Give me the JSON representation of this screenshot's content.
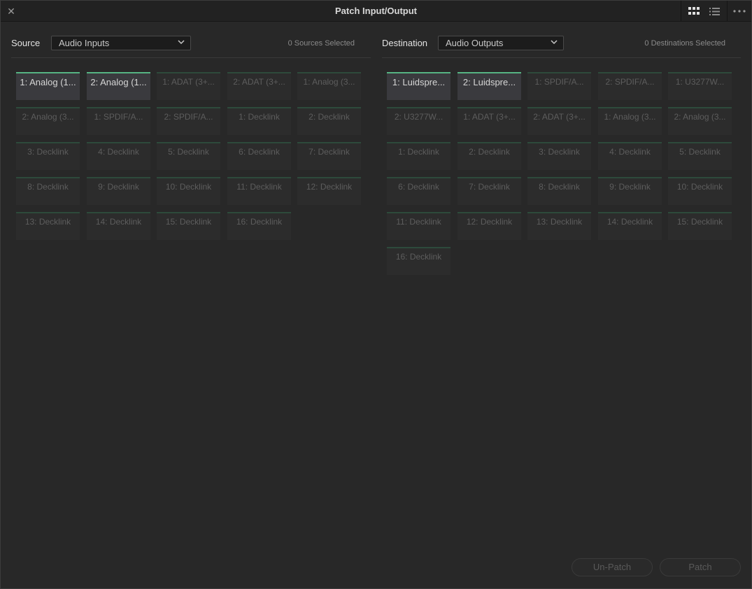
{
  "window": {
    "title": "Patch Input/Output"
  },
  "icons": {
    "close": "close-icon",
    "grid_view": "grid-view-icon",
    "list_view": "list-view-icon",
    "more": "more-options-icon",
    "chevron": "chevron-down-icon"
  },
  "colors": {
    "active_accent": "#56b483",
    "inactive_accent": "#2d4a3b",
    "background": "#282828"
  },
  "source": {
    "label": "Source",
    "dropdown_value": "Audio Inputs",
    "count_text": "0 Sources Selected",
    "tiles": [
      {
        "label": "1: Analog (1...",
        "active": true
      },
      {
        "label": "2: Analog (1...",
        "active": true
      },
      {
        "label": "1: ADAT (3+...",
        "active": false
      },
      {
        "label": "2: ADAT (3+...",
        "active": false
      },
      {
        "label": "1: Analog (3...",
        "active": false
      },
      {
        "label": "2: Analog (3...",
        "active": false
      },
      {
        "label": "1: SPDIF/A...",
        "active": false
      },
      {
        "label": "2: SPDIF/A...",
        "active": false
      },
      {
        "label": "1: Decklink",
        "active": false
      },
      {
        "label": "2: Decklink",
        "active": false
      },
      {
        "label": "3: Decklink",
        "active": false
      },
      {
        "label": "4: Decklink",
        "active": false
      },
      {
        "label": "5: Decklink",
        "active": false
      },
      {
        "label": "6: Decklink",
        "active": false
      },
      {
        "label": "7: Decklink",
        "active": false
      },
      {
        "label": "8: Decklink",
        "active": false
      },
      {
        "label": "9: Decklink",
        "active": false
      },
      {
        "label": "10: Decklink",
        "active": false
      },
      {
        "label": "11: Decklink",
        "active": false
      },
      {
        "label": "12: Decklink",
        "active": false
      },
      {
        "label": "13: Decklink",
        "active": false
      },
      {
        "label": "14: Decklink",
        "active": false
      },
      {
        "label": "15: Decklink",
        "active": false
      },
      {
        "label": "16: Decklink",
        "active": false
      }
    ]
  },
  "destination": {
    "label": "Destination",
    "dropdown_value": "Audio Outputs",
    "count_text": "0 Destinations Selected",
    "tiles": [
      {
        "label": "1: Luidspre...",
        "active": true
      },
      {
        "label": "2: Luidspre...",
        "active": true
      },
      {
        "label": "1: SPDIF/A...",
        "active": false
      },
      {
        "label": "2: SPDIF/A...",
        "active": false
      },
      {
        "label": "1: U3277W...",
        "active": false
      },
      {
        "label": "2: U3277W...",
        "active": false
      },
      {
        "label": "1: ADAT (3+...",
        "active": false
      },
      {
        "label": "2: ADAT (3+...",
        "active": false
      },
      {
        "label": "1: Analog (3...",
        "active": false
      },
      {
        "label": "2: Analog (3...",
        "active": false
      },
      {
        "label": "1: Decklink",
        "active": false
      },
      {
        "label": "2: Decklink",
        "active": false
      },
      {
        "label": "3: Decklink",
        "active": false
      },
      {
        "label": "4: Decklink",
        "active": false
      },
      {
        "label": "5: Decklink",
        "active": false
      },
      {
        "label": "6: Decklink",
        "active": false
      },
      {
        "label": "7: Decklink",
        "active": false
      },
      {
        "label": "8: Decklink",
        "active": false
      },
      {
        "label": "9: Decklink",
        "active": false
      },
      {
        "label": "10: Decklink",
        "active": false
      },
      {
        "label": "11: Decklink",
        "active": false
      },
      {
        "label": "12: Decklink",
        "active": false
      },
      {
        "label": "13: Decklink",
        "active": false
      },
      {
        "label": "14: Decklink",
        "active": false
      },
      {
        "label": "15: Decklink",
        "active": false
      },
      {
        "label": "16: Decklink",
        "active": false
      }
    ]
  },
  "buttons": {
    "unpatch_label": "Un-Patch",
    "patch_label": "Patch"
  }
}
